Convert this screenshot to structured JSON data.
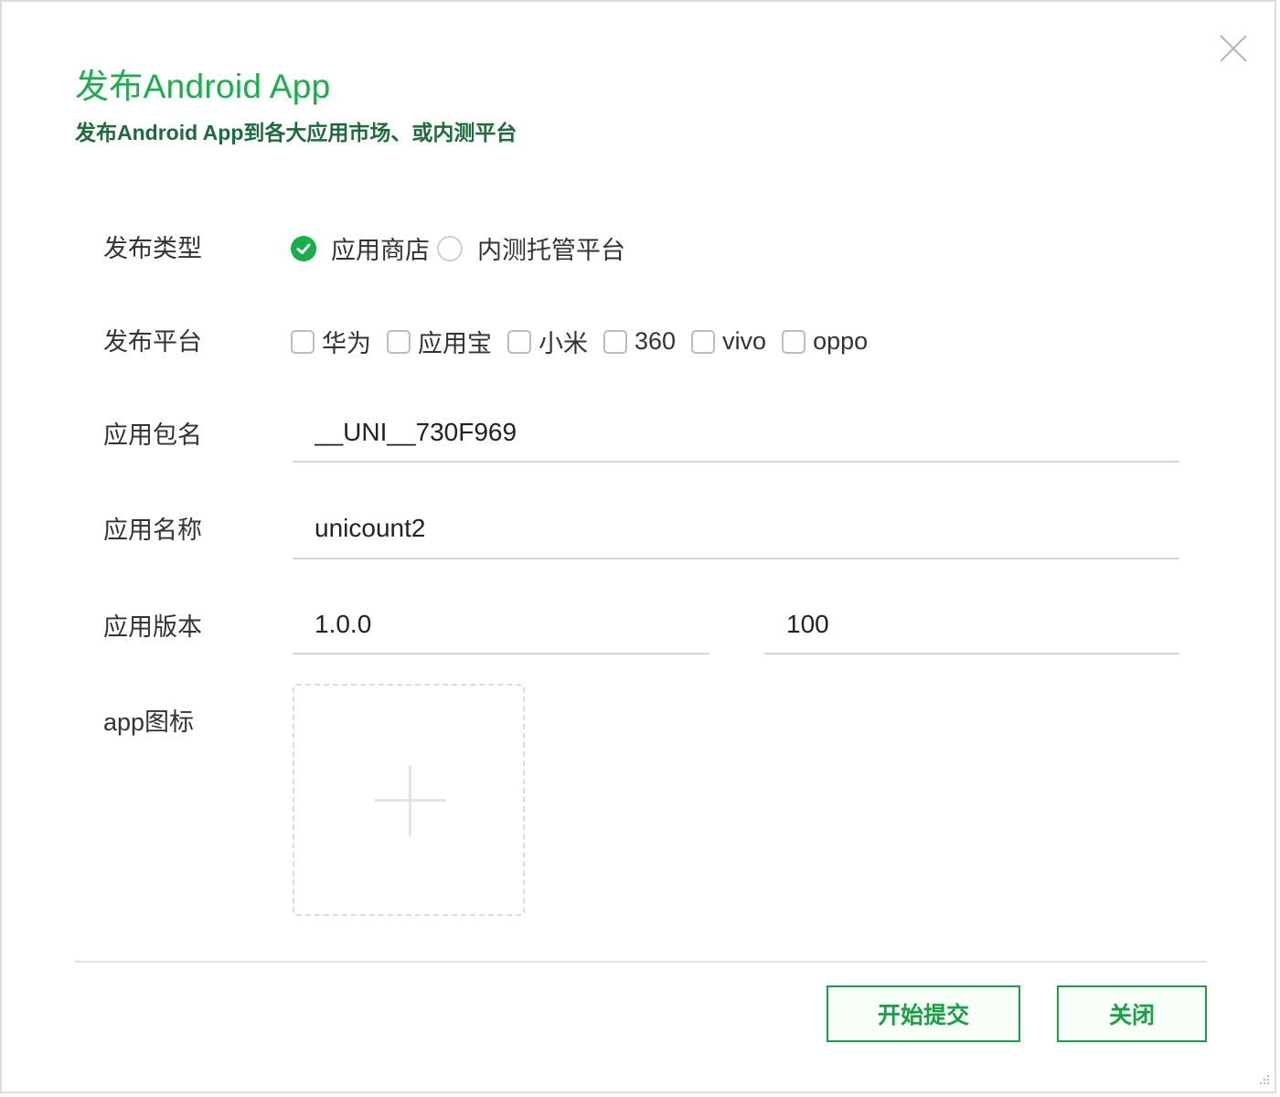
{
  "header": {
    "title": "发布Android App",
    "subtitle": "发布Android App到各大应用市场、或内测平台"
  },
  "form": {
    "publish_type": {
      "label": "发布类型",
      "options": [
        {
          "label": "应用商店",
          "checked": true
        },
        {
          "label": "内测托管平台",
          "checked": false
        }
      ]
    },
    "platforms": {
      "label": "发布平台",
      "options": [
        {
          "label": "华为",
          "checked": false
        },
        {
          "label": "应用宝",
          "checked": false
        },
        {
          "label": "小米",
          "checked": false
        },
        {
          "label": "360",
          "checked": false
        },
        {
          "label": "vivo",
          "checked": false
        },
        {
          "label": "oppo",
          "checked": false
        }
      ]
    },
    "package_name": {
      "label": "应用包名",
      "value": "__UNI__730F969"
    },
    "app_name": {
      "label": "应用名称",
      "value": "unicount2"
    },
    "version": {
      "label": "应用版本",
      "version_name": "1.0.0",
      "version_code": "100"
    },
    "icon": {
      "label": "app图标"
    }
  },
  "footer": {
    "submit_label": "开始提交",
    "close_label": "关闭"
  },
  "colors": {
    "accent": "#16b04a",
    "subtitle": "#1d6b3a",
    "button_border": "#16a244"
  },
  "icons": {
    "close": "close-icon",
    "check": "checkmark-icon",
    "plus": "plus-icon"
  }
}
